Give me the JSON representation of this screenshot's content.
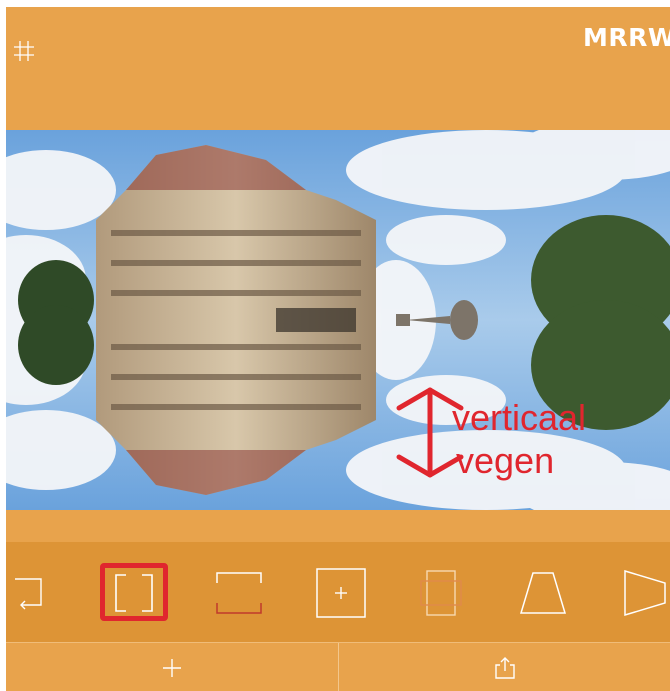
{
  "app": {
    "logo_text": "MRRW"
  },
  "icons": {
    "grid": "grid-icon",
    "add": "plus-icon",
    "share": "share-icon"
  },
  "annotation": {
    "line1": "verticaal",
    "line2": "vegen",
    "color": "#e0262e"
  },
  "toolbar": {
    "tools": [
      {
        "name": "mirror-mode-corner-icon",
        "selected": false
      },
      {
        "name": "mirror-mode-brackets-icon",
        "selected": true
      },
      {
        "name": "mirror-mode-split-horizontal-icon",
        "selected": false
      },
      {
        "name": "mirror-mode-quad-icon",
        "selected": false
      },
      {
        "name": "mirror-mode-overlap-icon",
        "selected": false
      },
      {
        "name": "perspective-trapezoid-icon",
        "selected": false
      },
      {
        "name": "perspective-side-icon",
        "selected": false
      }
    ]
  },
  "colors": {
    "background": "#e8a34c",
    "toolbar": "#dd9436",
    "highlight": "#e0262e"
  }
}
